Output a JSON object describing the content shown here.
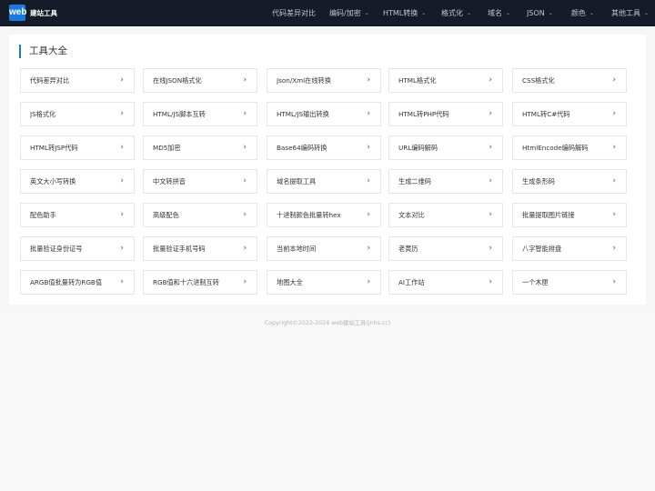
{
  "header": {
    "logo_text": "web",
    "brand_name": "建站工具",
    "nav": [
      {
        "label": "代码差异对比",
        "dropdown": false
      },
      {
        "label": "编码/加密",
        "dropdown": true
      },
      {
        "label": "HTML转换",
        "dropdown": true
      },
      {
        "label": "格式化",
        "dropdown": true
      },
      {
        "label": "域名",
        "dropdown": true
      },
      {
        "label": "JSON",
        "dropdown": true
      },
      {
        "label": "颜色",
        "dropdown": true
      },
      {
        "label": "其他工具",
        "dropdown": true
      }
    ],
    "chevron_icon": "chevron-down-icon"
  },
  "main": {
    "section_title": "工具大全",
    "tools": [
      "代码差异对比",
      "在线JSON格式化",
      "Json/Xml在线转换",
      "HTML格式化",
      "CSS格式化",
      "JS格式化",
      "HTML/JS脚本互转",
      "HTML/JS输出转换",
      "HTML转PHP代码",
      "HTML转C#代码",
      "HTML转JSP代码",
      "MD5加密",
      "Base64编码转换",
      "URL编码解码",
      "HtmlEncode编码解码",
      "英文大小写转换",
      "中文转拼音",
      "域名提取工具",
      "生成二维码",
      "生成条形码",
      "配色助手",
      "高级配色",
      "十进制颜色批量转hex",
      "文本对比",
      "批量提取图片链接",
      "批量验证身份证号",
      "批量验证手机号码",
      "当前本地时间",
      "老黄历",
      "八字智能排盘",
      "ARGB值批量转为RGB值",
      "RGB值和十六进制互转",
      "地图大全",
      "AI工作站",
      "一个木匣"
    ],
    "arrow_icon": "chevron-right-icon"
  },
  "footer": {
    "copyright": "Copyright©2022-2024 web建站工具(jnhs.cc)"
  },
  "colors": {
    "header_bg": "#161b29",
    "accent": "#1a7ae0",
    "page_bg": "#f5f6f7"
  }
}
